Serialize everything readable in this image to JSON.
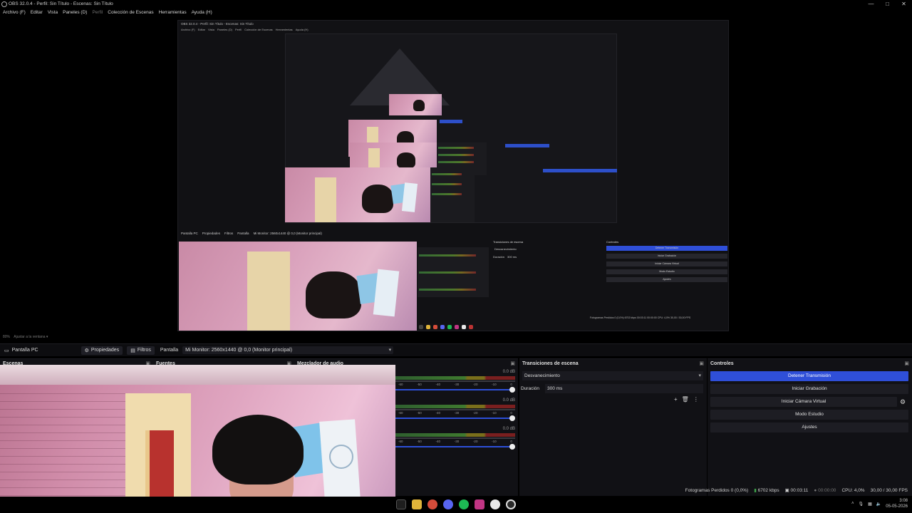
{
  "window": {
    "title": "OBS 32.0.4 - Perfil: Sin Título - Escenas: Sin Título",
    "controls": [
      "—",
      "□",
      "✕"
    ]
  },
  "menu": {
    "items": [
      {
        "label": "Archivo (F)",
        "dim": false
      },
      {
        "label": "Editar",
        "dim": false
      },
      {
        "label": "Vista",
        "dim": false
      },
      {
        "label": "Paneles (D)",
        "dim": false
      },
      {
        "label": "Perfil",
        "dim": true
      },
      {
        "label": "Colección de Escenas",
        "dim": false
      },
      {
        "label": "Herramientas",
        "dim": false
      },
      {
        "label": "Ayuda (H)",
        "dim": false
      }
    ]
  },
  "preview": {
    "nested_title": "OBS 32.0.4 - Perfil: Sin Título - Escenas: Sin Título",
    "nested_menu": [
      "Archivo (F)",
      "Editar",
      "Vista",
      "Paneles (D)",
      "Perfil",
      "Colección de Escenas",
      "Herramientas",
      "Ayuda (H)"
    ],
    "nested_source": "Pantalla PC",
    "nested_properties": "Propiedades",
    "nested_filters": "Filtros",
    "nested_display": "Pantalla",
    "nested_monitor": "Mi Monitor: 2560x1440 @ 0,0 (Monitor principal)",
    "nested_transitions": "Transiciones de escena",
    "nested_controls": "Controles",
    "nested_fade": "Desvanecimiento",
    "nested_duration": "Duración",
    "nested_duration_val": "300 ms",
    "nested_btn_stop": "Detener Transmisión",
    "nested_btn_rec": "Iniciar Grabación",
    "nested_btn_vcam": "Iniciar Cámara Virtual",
    "nested_btn_studio": "Modo Estudio",
    "nested_btn_settings": "Ajustes",
    "nested_status": "Fotogramas Perdidos 0 (0,0%)   6702 kbps   00:03:11   00:00:00   CPU: 4,0%   30,00 / 30,00 FPS"
  },
  "zoom": {
    "value": "80%",
    "fit_label": "Ajustar a la ventana"
  },
  "source_toolbar": {
    "source_name": "Pantalla PC",
    "properties_label": "Propiedades",
    "filters_label": "Filtros",
    "display_label": "Pantalla",
    "display_value": "Mi Monitor: 2560x1440 @ 0,0 (Monitor principal)"
  },
  "docks": {
    "scenes_title": "Escenas",
    "sources_title": "Fuentes",
    "mixer_title": "Mezclador de audio",
    "transitions_title": "Transiciones de escena",
    "controls_title": "Controles"
  },
  "mixer": {
    "channels": [
      {
        "db": "0.0 dB",
        "volume": 1.0
      },
      {
        "db": "0.0 dB",
        "volume": 1.0
      },
      {
        "db": "0.0 dB",
        "volume": 1.0
      }
    ],
    "ticks": [
      "-60",
      "-55",
      "-50",
      "-45",
      "-40",
      "-35",
      "-30",
      "-25",
      "-20",
      "-15",
      "-10",
      "-5",
      "0"
    ]
  },
  "transitions": {
    "selected": "Desvanecimiento",
    "duration_label": "Duración",
    "duration_value": "300 ms"
  },
  "controls": {
    "stop_stream": "Detener Transmisión",
    "start_recording": "Iniciar Grabación",
    "start_virtual_cam": "Iniciar Cámara Virtual",
    "studio_mode": "Modo Estudio",
    "settings": "Ajustes"
  },
  "status": {
    "dropped_frames": "Fotogramas Perdidos 0 (0,0%)",
    "bitrate": "6702 kbps",
    "stream_time": "00:03:11",
    "rec_time": "00:00:00",
    "cpu": "CPU: 4,0%",
    "fps": "30,00 / 30,00 FPS"
  },
  "taskbar": {
    "icons": [
      {
        "name": "start-icon",
        "color": "#1e1e1e"
      },
      {
        "name": "file-explorer-icon",
        "color": "#e0b43a"
      },
      {
        "name": "chrome-icon",
        "color": "#d64c3a"
      },
      {
        "name": "discord-icon",
        "color": "#5865f2"
      },
      {
        "name": "spotify-icon",
        "color": "#1db954"
      },
      {
        "name": "instagram-icon",
        "color": "#c13584"
      },
      {
        "name": "app-white-icon",
        "color": "#e8e8e8"
      },
      {
        "name": "obs-icon",
        "color": "#2a2a2a"
      }
    ],
    "time": "3:08",
    "date": "05-05-2026"
  }
}
